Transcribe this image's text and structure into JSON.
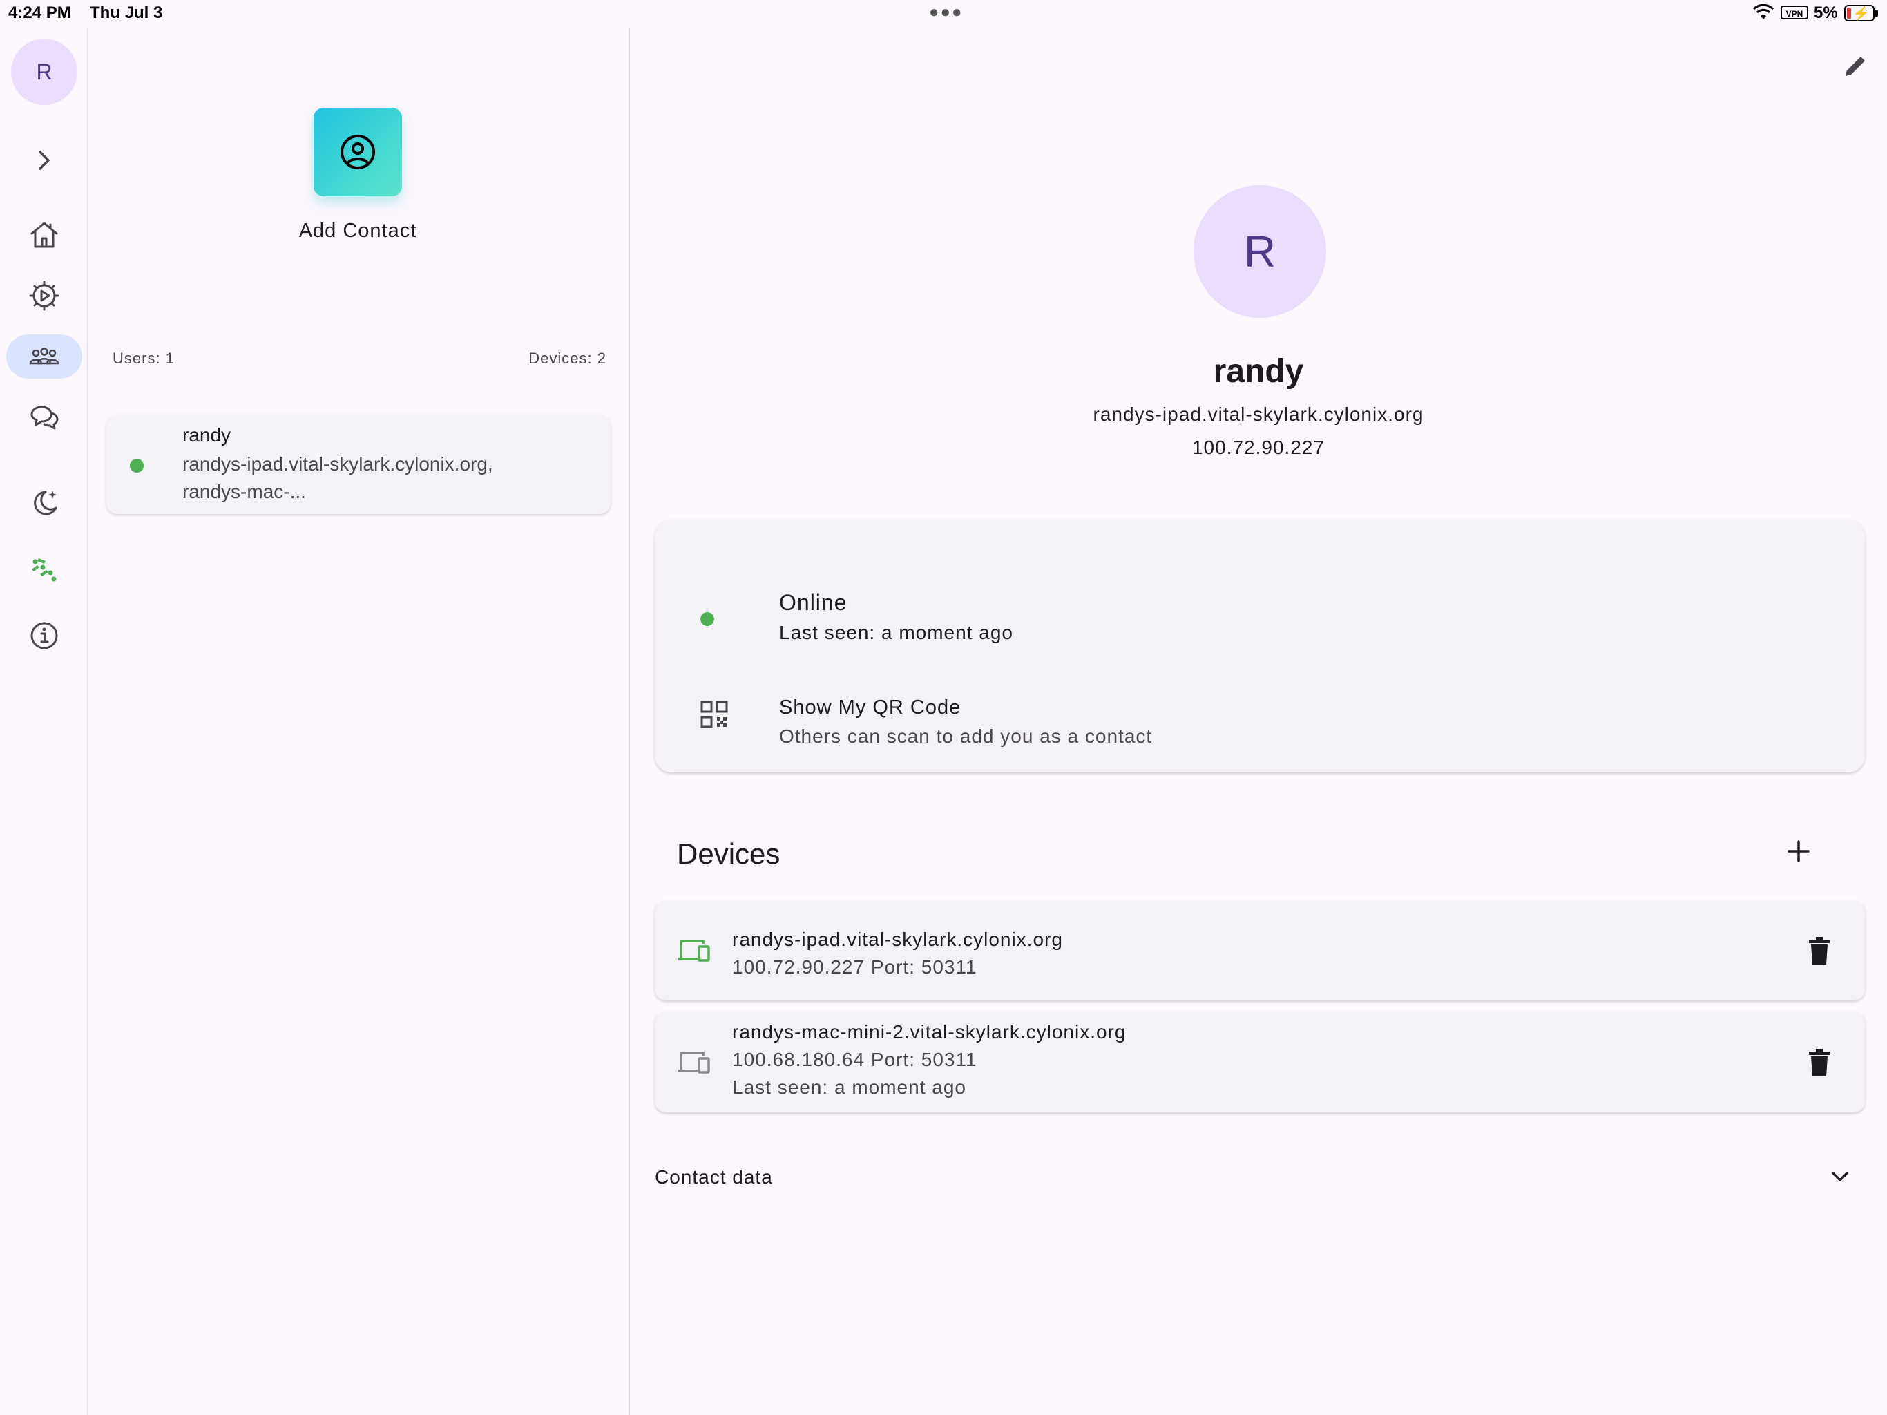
{
  "status_bar": {
    "time": "4:24 PM",
    "date": "Thu Jul 3",
    "vpn": "VPN",
    "battery": "5%"
  },
  "rail": {
    "avatar_initial": "R",
    "items": [
      {
        "name": "expand",
        "icon": "chevron-right-icon"
      },
      {
        "name": "home",
        "icon": "home-icon"
      },
      {
        "name": "settings",
        "icon": "gear-play-icon"
      },
      {
        "name": "contacts",
        "icon": "people-icon",
        "active": true
      },
      {
        "name": "chats",
        "icon": "chat-icon"
      },
      {
        "name": "theme",
        "icon": "moon-sparkle-icon"
      },
      {
        "name": "network",
        "icon": "network-status-icon"
      },
      {
        "name": "about",
        "icon": "info-icon"
      }
    ]
  },
  "list": {
    "add_contact_label": "Add Contact",
    "users_count": "Users: 1",
    "devices_count": "Devices: 2",
    "contacts": [
      {
        "name": "randy",
        "devices_line1": "randys-ipad.vital-skylark.cylonix.org,",
        "devices_line2": "randys-mac-...",
        "online": true
      }
    ]
  },
  "detail": {
    "avatar_initial": "R",
    "name": "randy",
    "hostname": "randys-ipad.vital-skylark.cylonix.org",
    "ip": "100.72.90.227",
    "status": {
      "title": "Online",
      "subtitle": "Last seen: a moment ago"
    },
    "qr": {
      "title": "Show My QR Code",
      "subtitle": "Others can scan to add you as a contact"
    },
    "devices_title": "Devices",
    "devices": [
      {
        "name": "randys-ipad.vital-skylark.cylonix.org",
        "address": "100.72.90.227 Port: 50311",
        "online": true
      },
      {
        "name": "randys-mac-mini-2.vital-skylark.cylonix.org",
        "address": "100.68.180.64 Port: 50311",
        "last_seen": "Last seen: a moment ago",
        "online": false
      }
    ],
    "contact_data_label": "Contact data"
  },
  "colors": {
    "accent_green": "#4caf50",
    "avatar_bg": "#eaddff",
    "avatar_text": "#4f378b",
    "active_rail": "#dbe4ff",
    "background": "#fdf7fe"
  }
}
